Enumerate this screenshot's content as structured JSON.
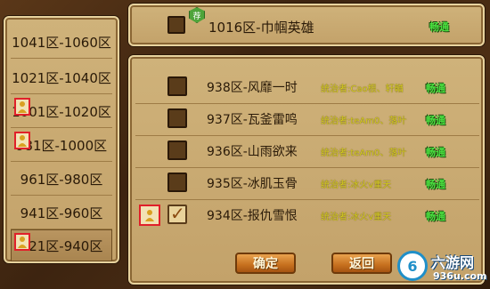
{
  "regions": [
    {
      "label": "1041区-1060区",
      "badge": false,
      "selected": false
    },
    {
      "label": "1021区-1040区",
      "badge": false,
      "selected": false
    },
    {
      "label": "1001区-1020区",
      "badge": true,
      "selected": false
    },
    {
      "label": "981区-1000区",
      "badge": true,
      "selected": false
    },
    {
      "label": "961区-980区",
      "badge": false,
      "selected": false
    },
    {
      "label": "941区-960区",
      "badge": false,
      "selected": false
    },
    {
      "label": "921区-940区",
      "badge": true,
      "selected": true
    }
  ],
  "top_server": {
    "name": "1016区-巾帼英雄",
    "status": "畅通",
    "tag": "荐"
  },
  "servers": [
    {
      "name": "938区-风靡一时",
      "ruler": "统治者:Cao根、轩輶",
      "status": "畅通",
      "checked": false,
      "badge": false
    },
    {
      "name": "937区-瓦釜雷鸣",
      "ruler": "统治者:teAm0、落叶",
      "status": "畅通",
      "checked": false,
      "badge": false
    },
    {
      "name": "936区-山雨欲来",
      "ruler": "统治者:teAm0、落叶",
      "status": "畅通",
      "checked": false,
      "badge": false
    },
    {
      "name": "935区-冰肌玉骨",
      "ruler": "统治者:冰火v重天",
      "status": "畅通",
      "checked": false,
      "badge": false
    },
    {
      "name": "934区-报仇雪恨",
      "ruler": "统治者:冰火v重天",
      "status": "畅通",
      "checked": true,
      "badge": true
    }
  ],
  "buttons": {
    "confirm": "确定",
    "back": "返回"
  },
  "watermark": {
    "logo_text": "6",
    "name": "六游网",
    "url": "936u.com"
  },
  "icons": {
    "player_marker": "person-icon",
    "check_mark": "checkmark-icon"
  }
}
